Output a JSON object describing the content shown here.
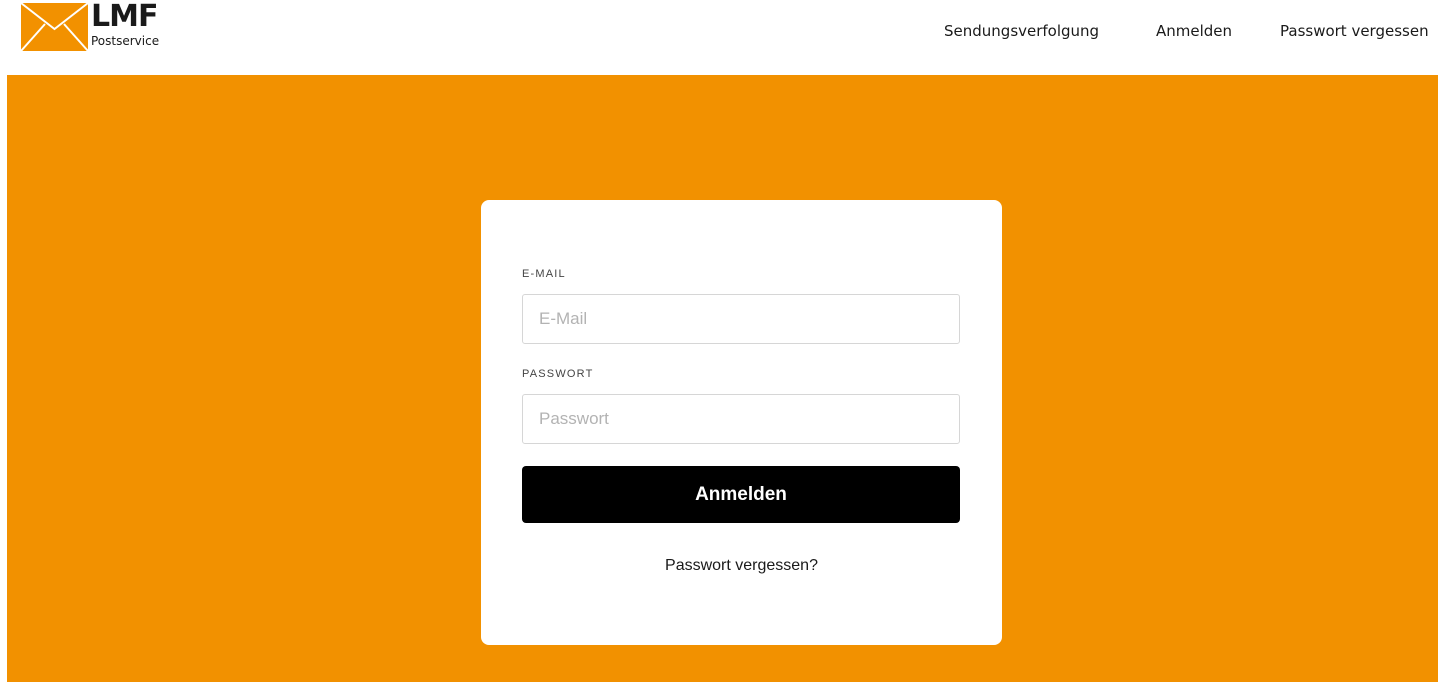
{
  "brand": {
    "name": "LMF",
    "tagline": "Postservice",
    "icon": "envelope-icon",
    "color": "#f29100"
  },
  "nav": {
    "tracking": "Sendungsverfolgung",
    "login": "Anmelden",
    "forgot": "Passwort vergessen"
  },
  "form": {
    "email_label": "E-MAIL",
    "email_placeholder": "E-Mail",
    "email_value": "",
    "password_label": "PASSWORT",
    "password_placeholder": "Passwort",
    "password_value": "",
    "submit_label": "Anmelden",
    "forgot_label": "Passwort vergessen?"
  },
  "colors": {
    "accent": "#f29100",
    "button": "#000000",
    "card": "#ffffff"
  }
}
